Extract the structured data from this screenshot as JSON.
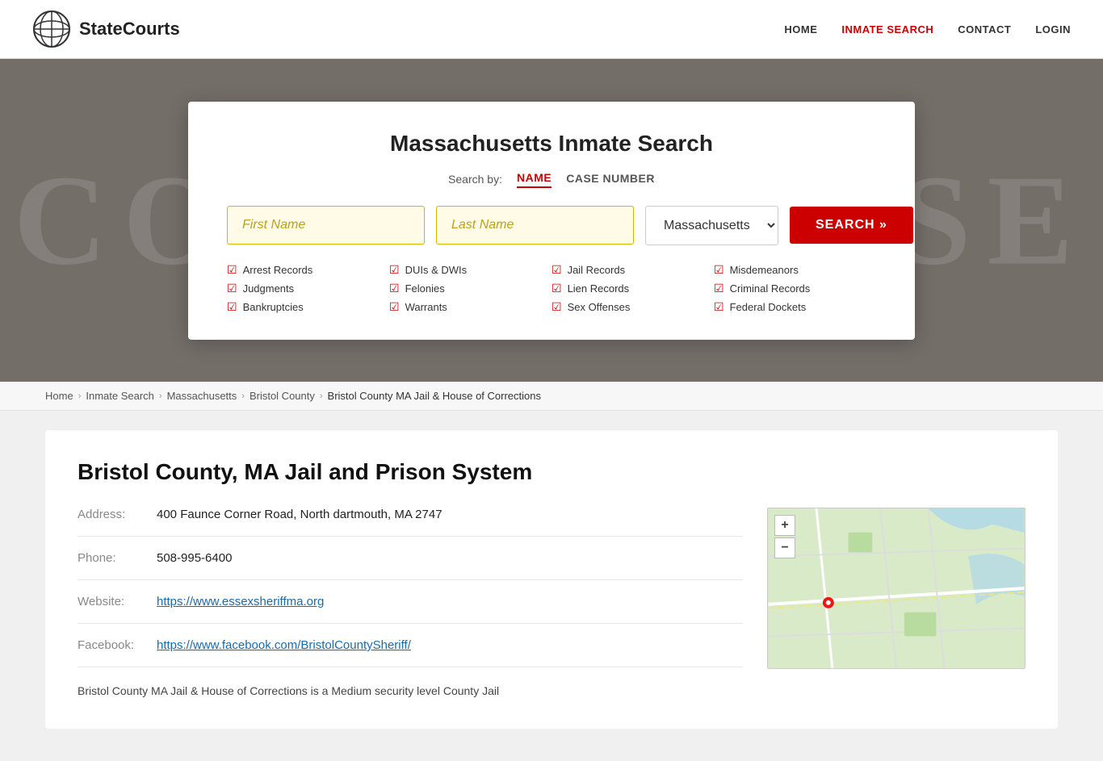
{
  "header": {
    "logo_text": "StateCourts",
    "nav": [
      {
        "label": "HOME",
        "id": "home",
        "active": false
      },
      {
        "label": "INMATE SEARCH",
        "id": "inmate-search",
        "active": true
      },
      {
        "label": "CONTACT",
        "id": "contact",
        "active": false
      },
      {
        "label": "LOGIN",
        "id": "login",
        "active": false
      }
    ]
  },
  "hero": {
    "bg_text": "COURTHOUSE"
  },
  "search_card": {
    "title": "Massachusetts Inmate Search",
    "search_by_label": "Search by:",
    "tabs": [
      {
        "label": "NAME",
        "active": true
      },
      {
        "label": "CASE NUMBER",
        "active": false
      }
    ],
    "first_name_placeholder": "First Name",
    "last_name_placeholder": "Last Name",
    "state_value": "Massachusetts",
    "state_options": [
      "Massachusetts"
    ],
    "search_button_label": "SEARCH »",
    "checks": [
      {
        "label": "Arrest Records"
      },
      {
        "label": "DUIs & DWIs"
      },
      {
        "label": "Jail Records"
      },
      {
        "label": "Misdemeanors"
      },
      {
        "label": "Judgments"
      },
      {
        "label": "Felonies"
      },
      {
        "label": "Lien Records"
      },
      {
        "label": "Criminal Records"
      },
      {
        "label": "Bankruptcies"
      },
      {
        "label": "Warrants"
      },
      {
        "label": "Sex Offenses"
      },
      {
        "label": "Federal Dockets"
      }
    ]
  },
  "breadcrumb": {
    "items": [
      {
        "label": "Home",
        "link": true
      },
      {
        "label": "Inmate Search",
        "link": true
      },
      {
        "label": "Massachusetts",
        "link": true
      },
      {
        "label": "Bristol County",
        "link": true
      },
      {
        "label": "Bristol County MA Jail & House of Corrections",
        "link": false
      }
    ]
  },
  "facility": {
    "title": "Bristol County, MA Jail and Prison System",
    "address_label": "Address:",
    "address_value": "400 Faunce Corner Road, North dartmouth, MA 2747",
    "phone_label": "Phone:",
    "phone_value": "508-995-6400",
    "website_label": "Website:",
    "website_url": "https://www.essexsheriffma.org",
    "facebook_label": "Facebook:",
    "facebook_url": "https://www.facebook.com/BristolCountySheriff/",
    "snippet": "Bristol County MA Jail & House of Corrections is a Medium security level County Jail",
    "map": {
      "zoom_in_label": "+",
      "zoom_out_label": "−"
    }
  }
}
